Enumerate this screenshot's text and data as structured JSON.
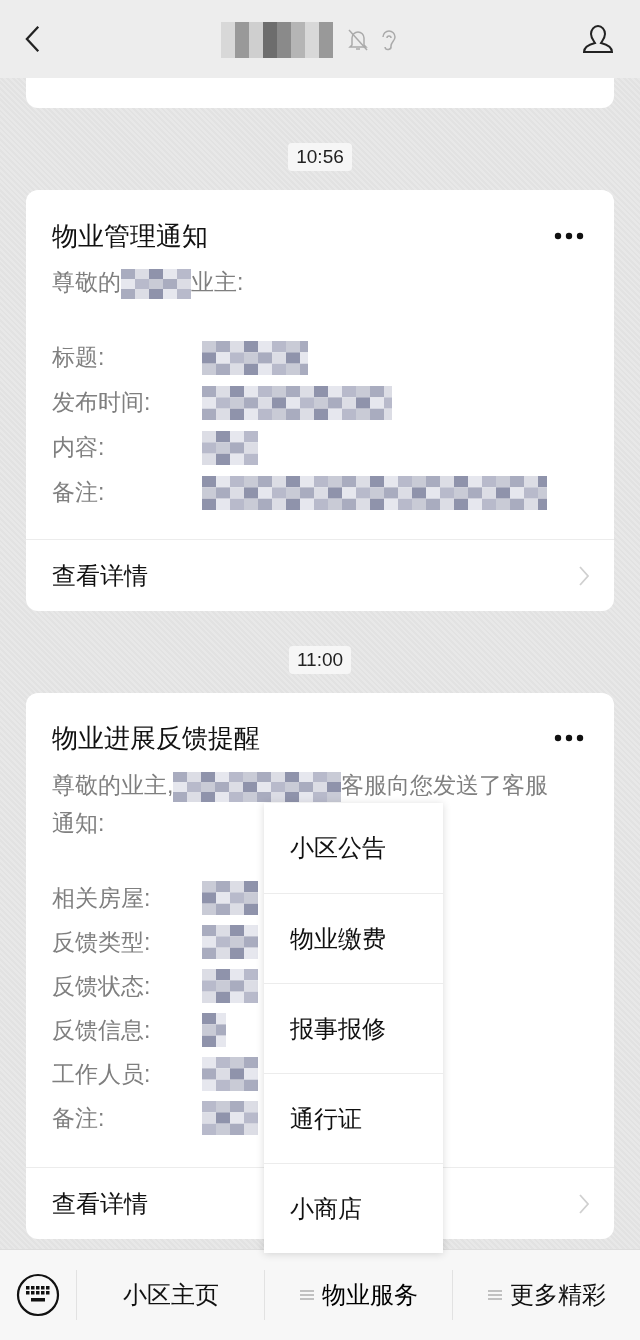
{
  "header": {
    "title": {
      "kind": "redacted"
    },
    "muted": true,
    "earpiece": true
  },
  "messages": [
    {
      "kind": "fragment"
    },
    {
      "kind": "time",
      "text": "10:56"
    },
    {
      "kind": "card",
      "title": "物业管理通知",
      "greeting": [
        {
          "kind": "text",
          "text": "尊敬的"
        },
        {
          "kind": "redacted"
        },
        {
          "kind": "text",
          "text": "业主:"
        }
      ],
      "fields": [
        {
          "label": "标题:",
          "value": {
            "kind": "redacted"
          }
        },
        {
          "label": "发布时间:",
          "value": {
            "kind": "redacted"
          }
        },
        {
          "label": "内容:",
          "value": {
            "kind": "redacted"
          }
        },
        {
          "label": "备注:",
          "value": {
            "kind": "redacted"
          }
        }
      ],
      "link": "查看详情"
    },
    {
      "kind": "time",
      "text": "11:00"
    },
    {
      "kind": "card",
      "title": "物业进展反馈提醒",
      "greeting": [
        {
          "kind": "text",
          "text": "尊敬的业主,"
        },
        {
          "kind": "redacted"
        },
        {
          "kind": "text",
          "text": "客服向您发送了客服"
        },
        {
          "kind": "text",
          "text": "通知:"
        }
      ],
      "fields": [
        {
          "label": "相关房屋:",
          "value": {
            "kind": "redacted"
          }
        },
        {
          "label": "反馈类型:",
          "value": {
            "kind": "redacted"
          }
        },
        {
          "label": "反馈状态:",
          "value": {
            "kind": "redacted"
          }
        },
        {
          "label": "反馈信息:",
          "value": {
            "kind": "redacted"
          }
        },
        {
          "label": "工作人员:",
          "value": {
            "kind": "redacted"
          }
        },
        {
          "label": "备注:",
          "value": {
            "kind": "redacted"
          }
        }
      ],
      "link": "查看详情"
    }
  ],
  "bottom_menu": [
    {
      "label": "小区主页",
      "has_submenu": false,
      "expanded": false
    },
    {
      "label": "物业服务",
      "has_submenu": true,
      "expanded": true,
      "submenu": [
        "小区公告",
        "物业缴费",
        "报事报修",
        "通行证",
        "小商店"
      ]
    },
    {
      "label": "更多精彩",
      "has_submenu": true,
      "expanded": false
    }
  ]
}
